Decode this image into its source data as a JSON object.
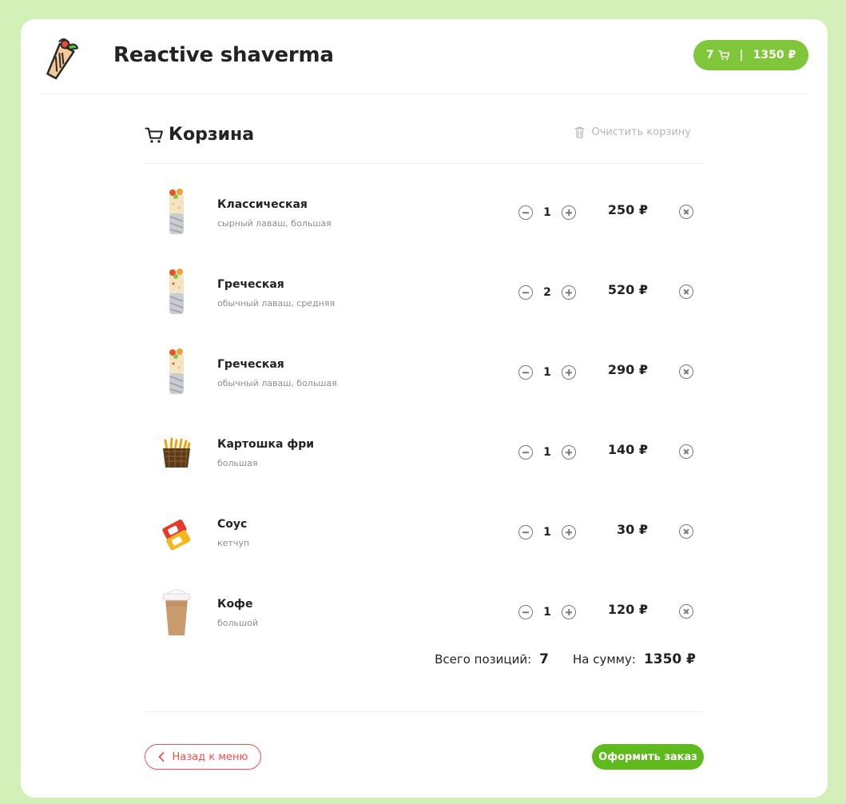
{
  "colors": {
    "page_bg": "#d3f0b8",
    "accent_green": "#7fc63a",
    "order_green": "#5fba1d",
    "back_red": "#ef4f4f"
  },
  "header": {
    "logo_icon": "shaverma-logo-icon",
    "title": "Reactive shaverma",
    "cart_count": "7",
    "cart_separator": "|",
    "cart_total": "1350 ₽"
  },
  "cart": {
    "title": "Корзина",
    "clear_label": "Очистить корзину",
    "items": [
      {
        "name": "Классическая",
        "desc": "сырный лаваш, большая",
        "qty": "1",
        "price": "250 ₽",
        "icon": "shaverma-image"
      },
      {
        "name": "Греческая",
        "desc": "обычный лаваш, средняя",
        "qty": "2",
        "price": "520 ₽",
        "icon": "shaverma-image"
      },
      {
        "name": "Греческая",
        "desc": "обычный лаваш, большая",
        "qty": "1",
        "price": "290 ₽",
        "icon": "shaverma-image"
      },
      {
        "name": "Картошка фри",
        "desc": "большая",
        "qty": "1",
        "price": "140 ₽",
        "icon": "fries-image"
      },
      {
        "name": "Соус",
        "desc": "кетчуп",
        "qty": "1",
        "price": "30 ₽",
        "icon": "sauce-image"
      },
      {
        "name": "Кофе",
        "desc": "большой",
        "qty": "1",
        "price": "120 ₽",
        "icon": "coffee-image"
      }
    ],
    "totals": {
      "count_label": "Всего позиций:",
      "count_value": "7",
      "sum_label": "На сумму:",
      "sum_value": "1350 ₽"
    },
    "back_label": "Назад к меню",
    "order_label": "Оформить заказ"
  }
}
